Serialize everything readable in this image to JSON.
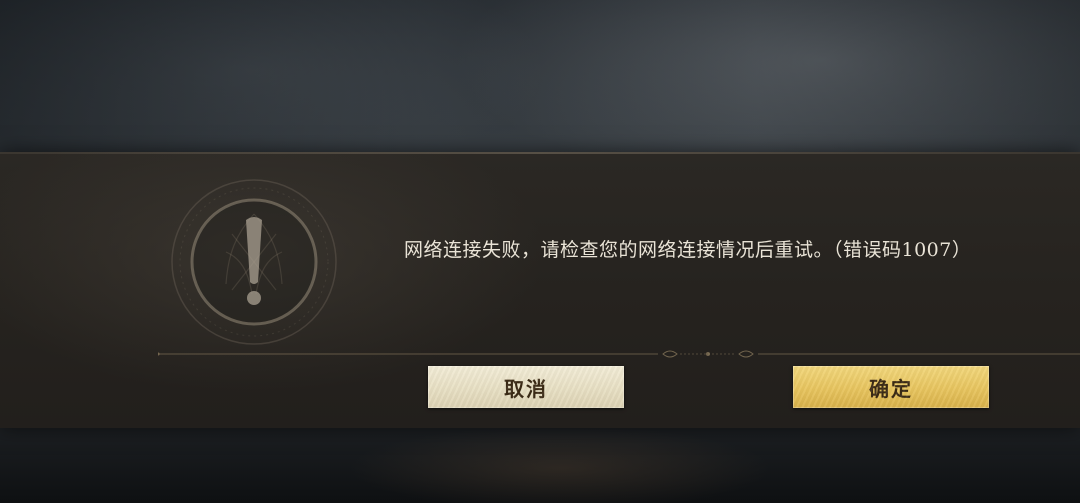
{
  "dialog": {
    "message": "网络连接失败，请检查您的网络连接情况后重试。（错误码1007）",
    "icon": "exclamation-emblem-icon",
    "divider_ornament": "ornament-icon"
  },
  "buttons": {
    "cancel_label": "取消",
    "confirm_label": "确定"
  },
  "colors": {
    "cancel_button": "#ebe4c9",
    "confirm_button": "#e9c660",
    "button_text": "#3b2a15",
    "message_text": "#e9e3d6",
    "dialog_bg": "#27241f"
  }
}
